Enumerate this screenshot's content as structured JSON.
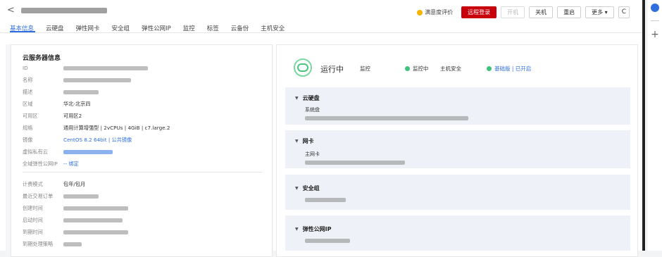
{
  "header": {
    "back_glyph": "<",
    "tabs": [
      "基本信息",
      "云硬盘",
      "弹性网卡",
      "安全组",
      "弹性公网IP",
      "监控",
      "标签",
      "云备份",
      "主机安全"
    ],
    "satisfaction": "满意度评价",
    "buttons": {
      "remote_login": "远程登录",
      "power_on": "开机",
      "power_off": "关机",
      "restart": "重启",
      "more": "更多 ▾",
      "refresh": "C"
    }
  },
  "server_info": {
    "title": "云服务器信息",
    "rows": [
      {
        "label": "ID",
        "value": ""
      },
      {
        "label": "名称",
        "value": ""
      },
      {
        "label": "描述",
        "value": ""
      },
      {
        "label": "区域",
        "value": "华北-北京四"
      },
      {
        "label": "可用区",
        "value": "可用区2"
      },
      {
        "label": "规格",
        "value": "通用计算增强型 | 2vCPUs | 4GiB | c7.large.2"
      },
      {
        "label": "镜像",
        "value": "CentOS 8.2 64bit | 公共镜像"
      },
      {
        "label": "虚拟私有云",
        "value": ""
      },
      {
        "label": "全域弹性公网IP",
        "value": "-- 绑定"
      }
    ],
    "billing_rows": [
      {
        "label": "计费模式",
        "value": "包年/包月"
      },
      {
        "label": "最近交易订单",
        "value": ""
      },
      {
        "label": "创建时间",
        "value": ""
      },
      {
        "label": "启动时间",
        "value": ""
      },
      {
        "label": "到期时间",
        "value": ""
      },
      {
        "label": "到期处理策略",
        "value": ""
      }
    ]
  },
  "status": {
    "text": "运行中",
    "monitor_label": "监控",
    "monitor_value": "监控中",
    "security_label": "主机安全",
    "security_value": "基础版 | 已开启"
  },
  "cards": {
    "disk": {
      "title": "云硬盘",
      "sub": "系统盘"
    },
    "nic": {
      "title": "网卡",
      "sub": "主网卡"
    },
    "sg": {
      "title": "安全组"
    },
    "eip": {
      "title": "弹性公网IP"
    }
  },
  "right_rail": {
    "plus": "+"
  },
  "colors": {
    "accent": "#2f6fe0",
    "primary_button": "#c7000b",
    "running": "#3fc37a"
  }
}
